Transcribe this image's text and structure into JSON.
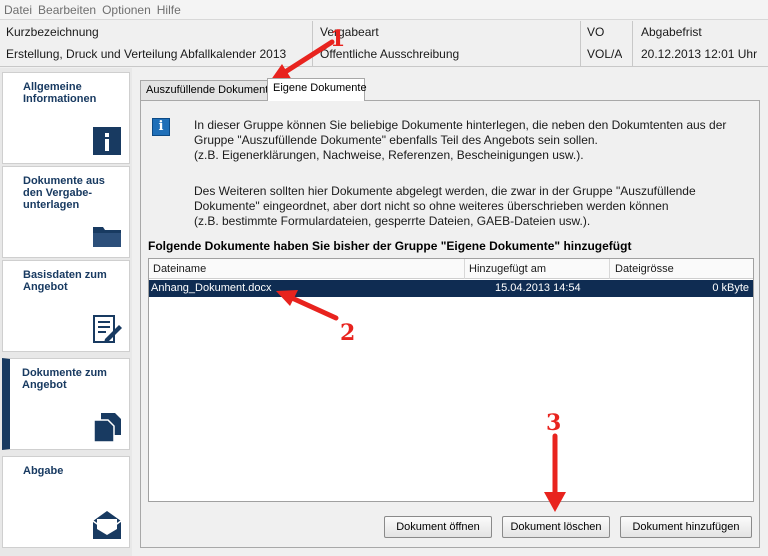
{
  "menubar": {
    "items": [
      "Datei",
      "Bearbeiten",
      "Optionen",
      "Hilfe"
    ]
  },
  "infobar": {
    "kurzbezeichnung_label": "Kurzbezeichnung",
    "kurzbezeichnung_value": "Erstellung, Druck und Verteilung Abfallkalender 2013",
    "vergabeart_label": "Vergabeart",
    "vergabeart_value": "Öffentliche Ausschreibung",
    "vo_label": "VO",
    "vo_value": "VOL/A",
    "abgabefrist_label": "Abgabefrist",
    "abgabefrist_value": "20.12.2013 12:01 Uhr"
  },
  "sidebar": {
    "items": [
      {
        "label": "Allgemeine Informationen",
        "icon": "info-icon"
      },
      {
        "label": "Dokumente aus den Vergabe-unterlagen",
        "icon": "folder-icon"
      },
      {
        "label": "Basisdaten zum Angebot",
        "icon": "edit-document-icon"
      },
      {
        "label": "Dokumente zum Angebot",
        "icon": "documents-icon"
      },
      {
        "label": "Abgabe",
        "icon": "envelope-icon"
      }
    ]
  },
  "tabs": [
    "Auszufüllende Dokumente",
    "Eigene Dokumente"
  ],
  "info": {
    "lines": [
      "In dieser Gruppe können Sie beliebige Dokumente hinterlegen, die neben den Dokumtenten aus der",
      "Gruppe \"Auszufüllende Dokumente\" ebenfalls Teil des Angebots sein sollen.",
      "(z.B. Eigenerklärungen, Nachweise, Referenzen, Bescheinigungen usw.).",
      "Des Weiteren sollten hier Dokumente abgelegt werden, die zwar in der Gruppe \"Auszufüllende",
      "Dokumente\" eingeordnet, aber dort nicht so ohne weiteres überschrieben werden können",
      "(z.B. bestimmte Formulardateien, gesperrte Dateien, GAEB-Dateien usw.)."
    ]
  },
  "section_title": "Folgende Dokumente haben Sie bisher der Gruppe \"Eigene Dokumente\" hinzugefügt",
  "table": {
    "columns": [
      "Dateiname",
      "Hinzugefügt am",
      "Dateigrösse"
    ],
    "rows": [
      {
        "name": "Anhang_Dokument.docx",
        "added": "15.04.2013 14:54",
        "size": "0 kByte"
      }
    ]
  },
  "buttons": {
    "open": "Dokument öffnen",
    "delete": "Dokument löschen",
    "add": "Dokument hinzufügen"
  },
  "annotations": [
    "1",
    "2",
    "3"
  ],
  "colors": {
    "accent": "#183a61",
    "selection": "#0f2c52",
    "annotation": "#e8231e"
  }
}
